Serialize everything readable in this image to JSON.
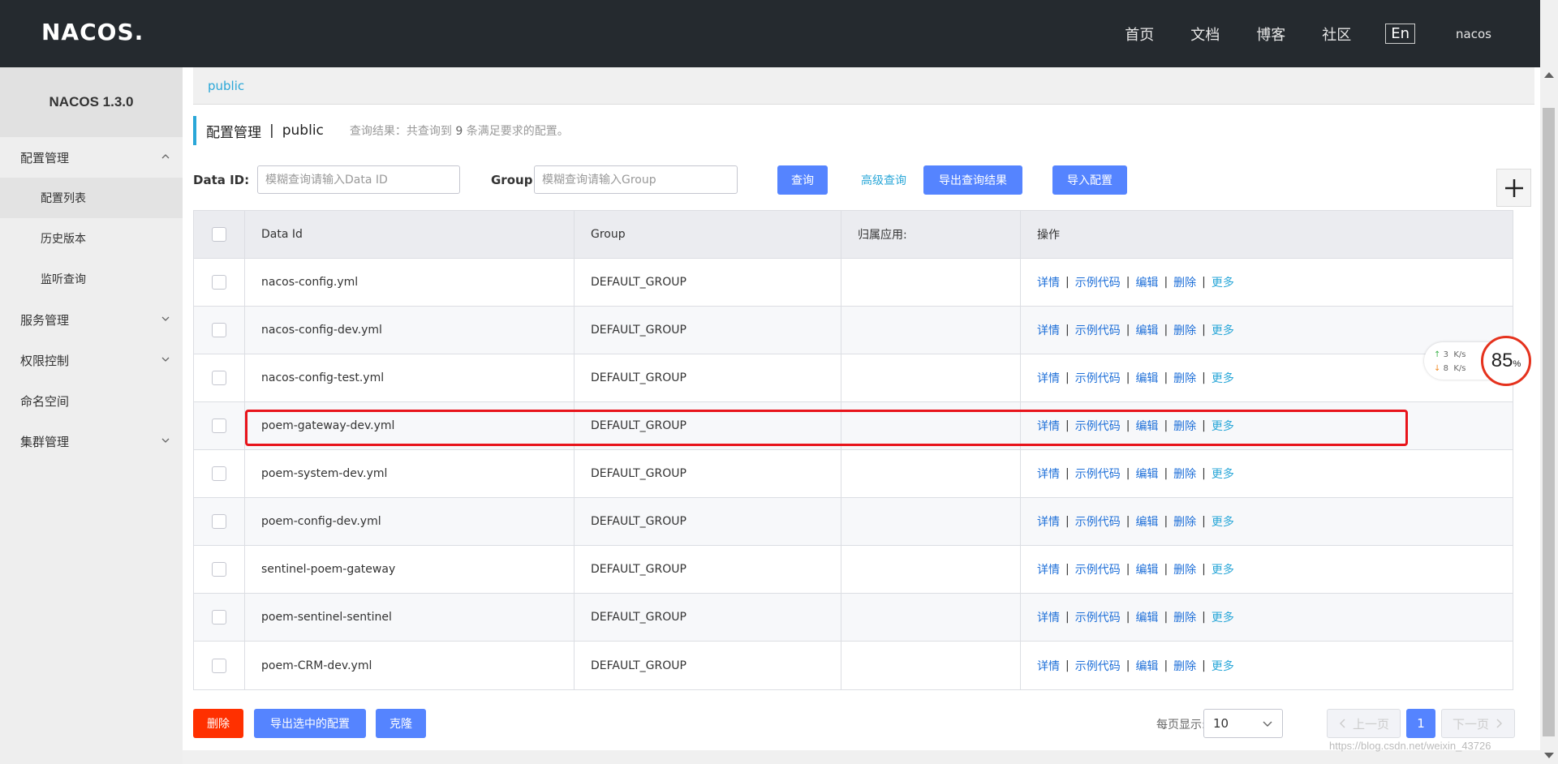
{
  "header": {
    "logo": "NACOS.",
    "nav": [
      "首页",
      "文档",
      "博客",
      "社区"
    ],
    "lang": "En",
    "user": "nacos"
  },
  "sidebar": {
    "version": "NACOS 1.3.0",
    "groups": [
      {
        "label": "配置管理",
        "items": [
          "配置列表",
          "历史版本",
          "监听查询"
        ]
      },
      {
        "label": "服务管理"
      },
      {
        "label": "权限控制"
      },
      {
        "label": "命名空间"
      },
      {
        "label": "集群管理"
      }
    ]
  },
  "namespace_bar": {
    "current": "public"
  },
  "page": {
    "title": "配置管理",
    "separator": "|",
    "namespace": "public",
    "result_prefix": "查询结果：共查询到",
    "result_count": "9",
    "result_suffix": "条满足要求的配置。"
  },
  "search": {
    "dataid_label": "Data ID:",
    "dataid_placeholder": "模糊查询请输入Data ID",
    "group_label": "Group:",
    "group_placeholder": "模糊查询请输入Group",
    "query_btn": "查询",
    "advanced_btn": "高级查询",
    "export_btn": "导出查询结果",
    "import_btn": "导入配置"
  },
  "table": {
    "columns": [
      "Data Id",
      "Group",
      "归属应用:",
      "操作"
    ],
    "ops": [
      "详情",
      "示例代码",
      "编辑",
      "删除",
      "更多"
    ],
    "rows": [
      {
        "data_id": "nacos-config.yml",
        "group": "DEFAULT_GROUP",
        "app": ""
      },
      {
        "data_id": "nacos-config-dev.yml",
        "group": "DEFAULT_GROUP",
        "app": ""
      },
      {
        "data_id": "nacos-config-test.yml",
        "group": "DEFAULT_GROUP",
        "app": ""
      },
      {
        "data_id": "poem-gateway-dev.yml",
        "group": "DEFAULT_GROUP",
        "app": ""
      },
      {
        "data_id": "poem-system-dev.yml",
        "group": "DEFAULT_GROUP",
        "app": ""
      },
      {
        "data_id": "poem-config-dev.yml",
        "group": "DEFAULT_GROUP",
        "app": ""
      },
      {
        "data_id": "sentinel-poem-gateway",
        "group": "DEFAULT_GROUP",
        "app": ""
      },
      {
        "data_id": "poem-sentinel-sentinel",
        "group": "DEFAULT_GROUP",
        "app": ""
      },
      {
        "data_id": "poem-CRM-dev.yml",
        "group": "DEFAULT_GROUP",
        "app": ""
      }
    ]
  },
  "footer": {
    "delete_btn": "删除",
    "export_selected_btn": "导出选中的配置",
    "clone_btn": "克隆",
    "page_size_label": "每页显示:",
    "page_size": "10",
    "prev": "上一页",
    "current_page": "1",
    "next": "下一页"
  },
  "speed_widget": {
    "up": "3",
    "down": "8",
    "unit": "K/s",
    "percent": "85",
    "percent_sign": "%"
  },
  "watermark": "https://blog.csdn.net/weixin_43726"
}
